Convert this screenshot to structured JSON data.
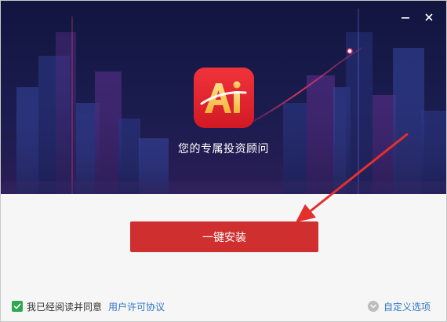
{
  "window": {
    "minimize_label": "—",
    "close_label": "✕"
  },
  "hero": {
    "tagline": "您的专属投资顾问",
    "logo_icon": "ai-app-logo-icon"
  },
  "main": {
    "install_button_label": "一键安装"
  },
  "footer": {
    "agree_checked": true,
    "agree_text": "我已经阅读并同意",
    "license_link": "用户许可协议",
    "custom_options_label": "自定义选项"
  },
  "colors": {
    "accent_red": "#cf2f2f",
    "hero_bg": "#12153f",
    "link_blue": "#2f77c8",
    "check_green": "#2fa84f"
  }
}
